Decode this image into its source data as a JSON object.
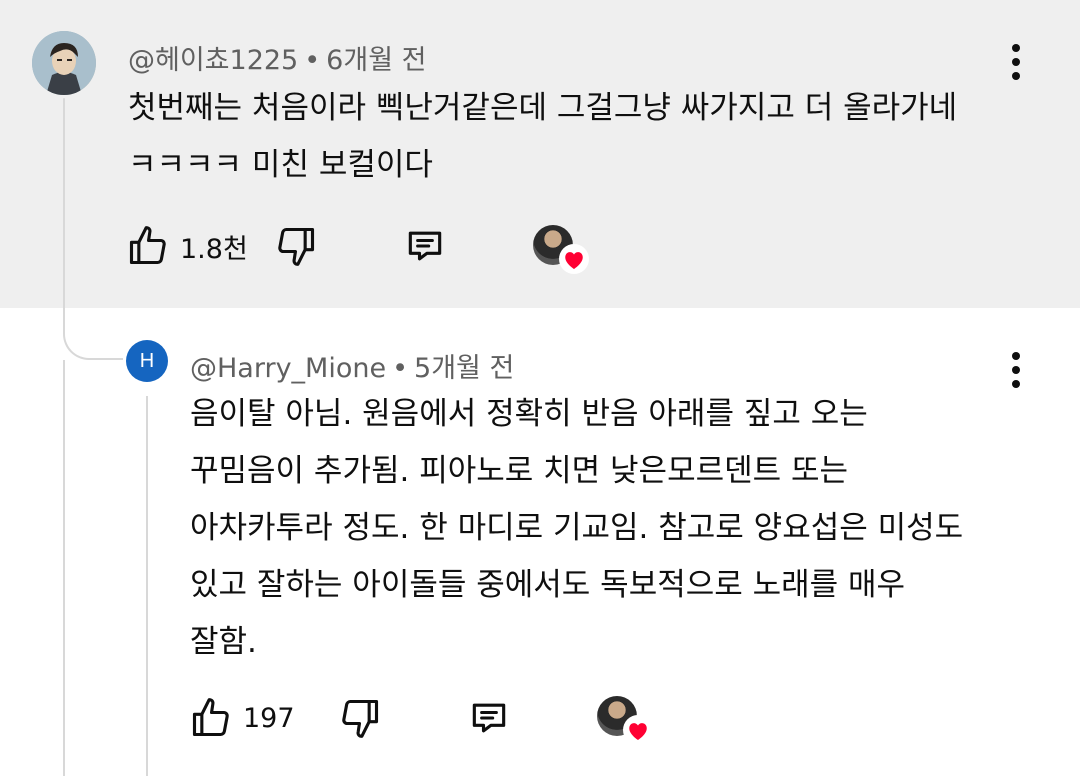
{
  "comments": [
    {
      "author": "@헤이쵸1225",
      "time": "6개월 전",
      "lines": [
        "첫번째는 처음이라 삑난거같은데 그걸그냥 싸가지고 더 올라가네",
        "ㅋㅋㅋㅋ 미친 보컬이다"
      ],
      "likes": "1.8천",
      "highlighted": true
    },
    {
      "author": "@Harry_Mione",
      "avatar_letter": "H",
      "time": "5개월 전",
      "lines": [
        "음이탈 아님. 원음에서 정확히 반음 아래를 짚고 오는",
        "꾸밈음이 추가됨. 피아노로 치면 낮은모르덴트 또는",
        "아차카투라 정도. 한 마디로 기교임. 참고로 양요섭은 미성도",
        "있고 잘하는 아이돌들 중에서도 독보적으로 노래를 매우",
        "잘함."
      ],
      "likes": "197"
    }
  ],
  "separator": "•",
  "colors": {
    "highlight": "#efefef",
    "avatar_blue": "#1565c0",
    "heart": "#ff0033"
  },
  "icons": [
    "thumb-up-icon",
    "thumb-down-icon",
    "reply-icon",
    "more-vert-icon",
    "heart-icon"
  ]
}
